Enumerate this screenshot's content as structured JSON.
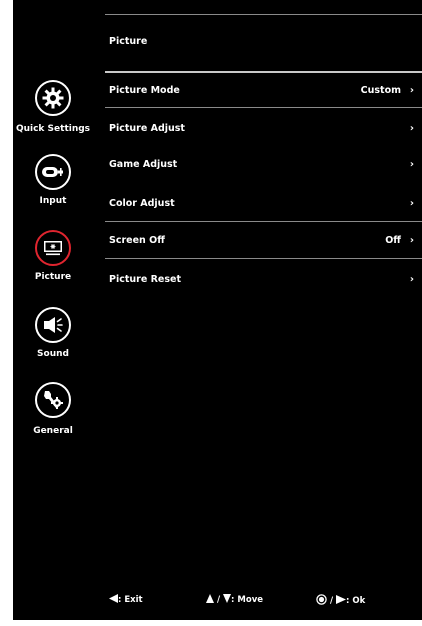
{
  "sidebar": {
    "items": [
      {
        "label": "Quick Settings",
        "icon": "gear-icon"
      },
      {
        "label": "Input",
        "icon": "input-icon"
      },
      {
        "label": "Picture",
        "icon": "monitor-icon"
      },
      {
        "label": "Sound",
        "icon": "speaker-icon"
      },
      {
        "label": "General",
        "icon": "tools-icon"
      }
    ],
    "active_index": 2
  },
  "main": {
    "title": "Picture",
    "rows": [
      {
        "label": "Picture Mode",
        "value": "Custom",
        "chevron": "›"
      },
      {
        "label": "Picture Adjust",
        "value": "",
        "chevron": "›"
      },
      {
        "label": "Game Adjust",
        "value": "",
        "chevron": "›"
      },
      {
        "label": "Color Adjust",
        "value": "",
        "chevron": "›"
      },
      {
        "label": "Screen Off",
        "value": "Off",
        "chevron": "›"
      },
      {
        "label": "Picture Reset",
        "value": "",
        "chevron": "›"
      }
    ]
  },
  "footer": {
    "exit": ": Exit",
    "move": ": Move",
    "move_sep": "/",
    "ok": ": Ok",
    "ok_sep": "/"
  },
  "colors": {
    "background": "#000000",
    "text": "#ffffff",
    "active_ring": "#e0252f"
  }
}
